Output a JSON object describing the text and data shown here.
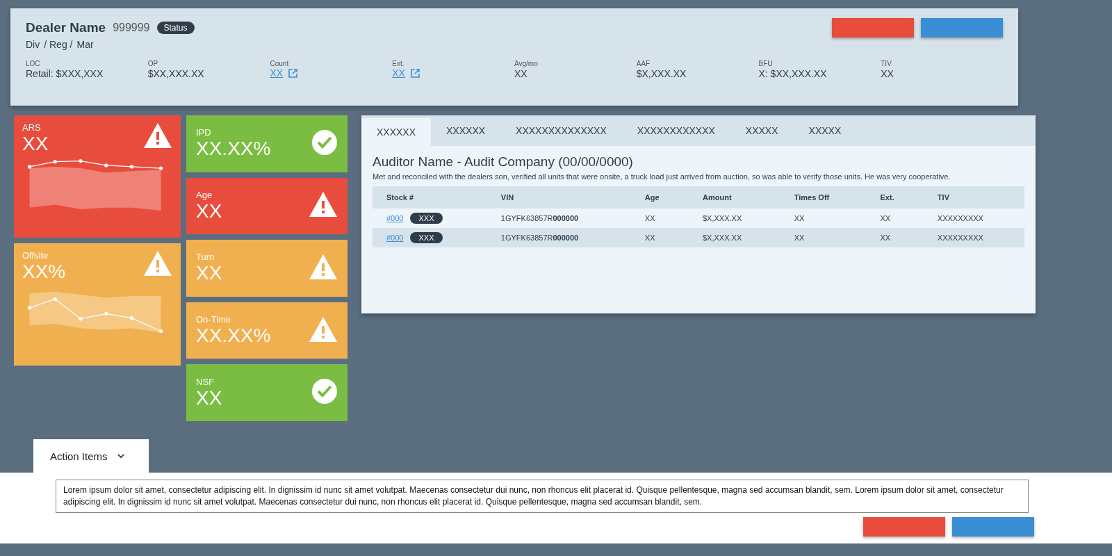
{
  "header": {
    "dealer_name": "Dealer Name",
    "dealer_number": "999999",
    "status": "Status",
    "breadcrumb": [
      "Div",
      "/ Reg /",
      "Mar"
    ],
    "fields": [
      {
        "label": "LOC",
        "value": "Retail: $XXX,XXX",
        "kind": "text"
      },
      {
        "label": "OP",
        "value": "$XX,XXX.XX",
        "kind": "text"
      },
      {
        "label": "Count",
        "value": "XX",
        "kind": "link"
      },
      {
        "label": "Ext.",
        "value": "XX",
        "kind": "link"
      },
      {
        "label": "Avg/mo",
        "value": "XX",
        "kind": "text"
      },
      {
        "label": "AAF",
        "value": "$X,XXX.XX",
        "kind": "text"
      },
      {
        "label": "BFU",
        "value": "X: $XX,XXX.XX",
        "kind": "text"
      },
      {
        "label": "TIV",
        "value": "XX",
        "kind": "text"
      }
    ],
    "buttons": [
      {
        "color": "#e84c3d"
      },
      {
        "color": "#3a8fd4"
      }
    ]
  },
  "chart_tiles": [
    {
      "label": "ARS",
      "value": "XX",
      "color": "#e84c3d",
      "kind": "warning"
    },
    {
      "label": "Offsite",
      "value": "XX%",
      "color": "#f1b04f",
      "kind": "warning"
    }
  ],
  "tiles": [
    {
      "label": "IPD",
      "value": "XX.XX%",
      "color": "#7bbd42",
      "kind": "ok"
    },
    {
      "label": "Age",
      "value": "XX",
      "color": "#e84c3d",
      "kind": "warning"
    },
    {
      "label": "Turn",
      "value": "XX",
      "color": "#f1b04f",
      "kind": "warning"
    },
    {
      "label": "On-Time",
      "value": "XX.XX%",
      "color": "#f1b04f",
      "kind": "warning"
    },
    {
      "label": "NSF",
      "value": "XX",
      "color": "#7bbd42",
      "kind": "ok"
    }
  ],
  "tabs": [
    {
      "label": "XXXXXX",
      "selected": true
    },
    {
      "label": "XXXXXX",
      "selected": false
    },
    {
      "label": "XXXXXXXXXXXXXX",
      "selected": false
    },
    {
      "label": "XXXXXXXXXXXX",
      "selected": false
    },
    {
      "label": "XXXXX",
      "selected": false
    },
    {
      "label": "XXXXX",
      "selected": false
    }
  ],
  "audit": {
    "title": "Auditor Name - Audit Company (00/00/0000)",
    "note": "Met and reconciled with the dealers son, verified all units that were onsite, a truck load just arrived from auction, so was able to verify those units. He was very cooperative."
  },
  "table": {
    "columns": [
      "Stock #",
      "VIN",
      "Age",
      "Amount",
      "Times Off",
      "Ext.",
      "TIV"
    ],
    "rows": [
      {
        "stock": "#000",
        "badge": "XXX",
        "vin": "1GYFK63857R**000000**",
        "age": "XX",
        "amount": "$X,XXX.XX",
        "times_off": "XX",
        "ext": "XX",
        "tiv": "XXXXXXXXX"
      },
      {
        "stock": "#000",
        "badge": "XXX",
        "vin": "1GYFK63857R**000000**",
        "age": "XX",
        "amount": "$X,XXX.XX",
        "times_off": "XX",
        "ext": "XX",
        "tiv": "XXXXXXXXX"
      }
    ]
  },
  "action_items": {
    "title": "Action Items",
    "text": "Lorem ipsum dolor sit amet, consectetur adipiscing elit. In dignissim id nunc sit amet volutpat. Maecenas consectetur dui nunc, non rhoncus elit placerat id. Quisque pellentesque, magna sed accumsan blandit, sem. Lorem ipsum dolor sit amet, consectetur adipiscing elit. In dignissim id nunc sit amet volutpat. Maecenas consectetur dui nunc, non rhoncus elit placerat id. Quisque pellentesque, magna sed accumsan blandit, sem.",
    "buttons": [
      {
        "color": "#e84c3d"
      },
      {
        "color": "#3a8fd4"
      }
    ]
  }
}
